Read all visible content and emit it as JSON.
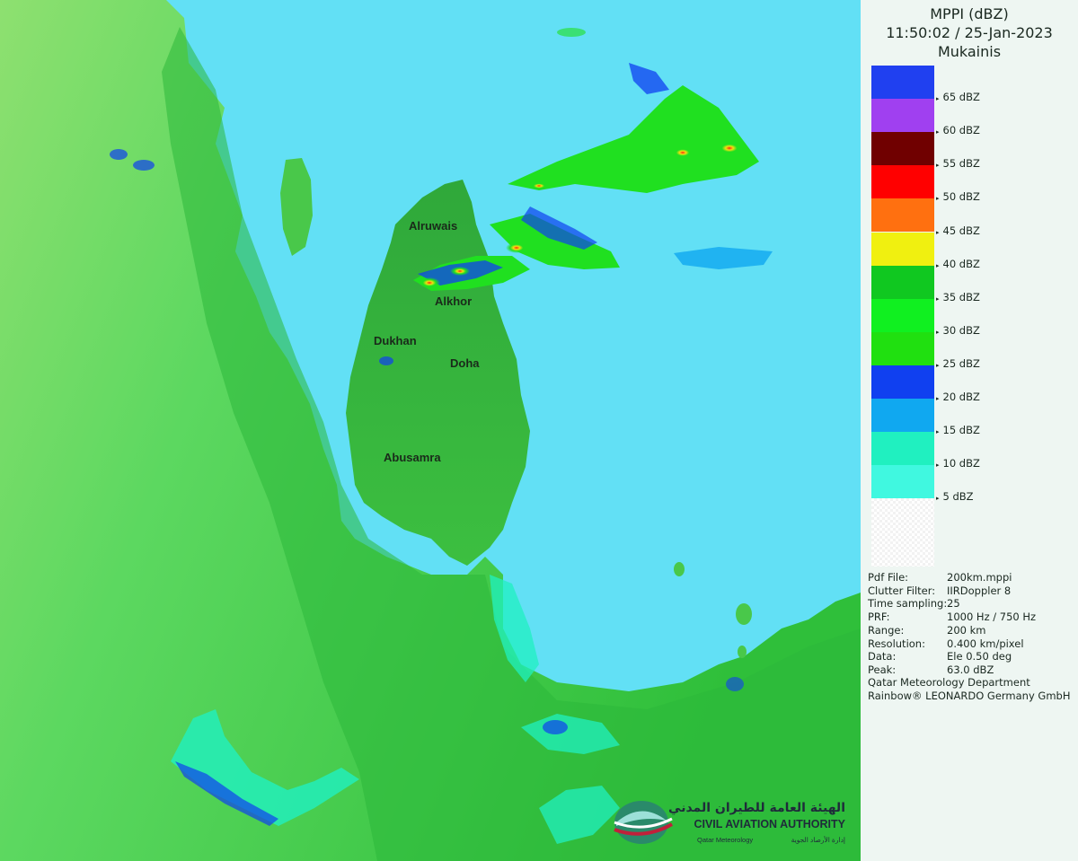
{
  "header": {
    "product": "MPPI (dBZ)",
    "datetime": "11:50:02 / 25-Jan-2023",
    "station": "Mukainis"
  },
  "legend": [
    {
      "label": "65 dBZ",
      "color": "#2040f0"
    },
    {
      "label": "60 dBZ",
      "color": "#a040f0"
    },
    {
      "label": "55 dBZ",
      "color": "#700000"
    },
    {
      "label": "50 dBZ",
      "color": "#ff0000"
    },
    {
      "label": "45 dBZ",
      "color": "#ff7010"
    },
    {
      "label": "40 dBZ",
      "color": "#f0f010"
    },
    {
      "label": "35 dBZ",
      "color": "#10c820"
    },
    {
      "label": "30 dBZ",
      "color": "#10f020"
    },
    {
      "label": "25 dBZ",
      "color": "#20e010"
    },
    {
      "label": "20 dBZ",
      "color": "#1040f0"
    },
    {
      "label": "15 dBZ",
      "color": "#10a8f0"
    },
    {
      "label": "10 dBZ",
      "color": "#20f0c0"
    },
    {
      "label": "5 dBZ",
      "color": "#40f8e0"
    }
  ],
  "metadata": [
    {
      "key": "Pdf File:",
      "value": "200km.mppi"
    },
    {
      "key": "Clutter Filter:",
      "value": "IIRDoppler 8"
    },
    {
      "key": "Time sampling:",
      "value": "25"
    },
    {
      "key": "PRF:",
      "value": "1000 Hz / 750 Hz"
    },
    {
      "key": "Range:",
      "value": "200 km"
    },
    {
      "key": "Resolution:",
      "value": "0.400 km/pixel"
    },
    {
      "key": "Data:",
      "value": "Ele 0.50 deg"
    },
    {
      "key": "Peak:",
      "value": "63.0 dBZ"
    }
  ],
  "credits": [
    "Qatar Meteorology Department",
    "Rainbow® LEONARDO Germany GmbH"
  ],
  "map": {
    "places": [
      "Alruwais",
      "Alkhor",
      "Dukhan",
      "Doha",
      "Abusamra"
    ],
    "sea_color": "#62e0f5",
    "land_color": "#3cc83c"
  },
  "logo": {
    "arabic": "الهيئة العامة للطيران المدني",
    "english": "CIVIL AVIATION AUTHORITY",
    "sub_en": "Qatar Meteorology",
    "sub_ar": "إدارة الأرصاد الجوية"
  }
}
